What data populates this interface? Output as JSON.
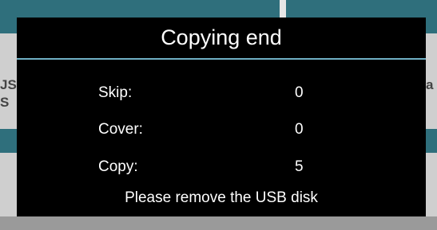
{
  "background": {
    "left_partial_text": "JS\nS",
    "right_partial_text": "a"
  },
  "dialog": {
    "title": "Copying end",
    "rows": [
      {
        "label": "Skip:",
        "value": "0"
      },
      {
        "label": "Cover:",
        "value": "0"
      },
      {
        "label": "Copy:",
        "value": "5"
      }
    ],
    "message": "Please remove the USB disk"
  },
  "colors": {
    "dialog_background": "#000000",
    "divider": "#6fb0c4",
    "app_accent": "#2f6f7c"
  }
}
